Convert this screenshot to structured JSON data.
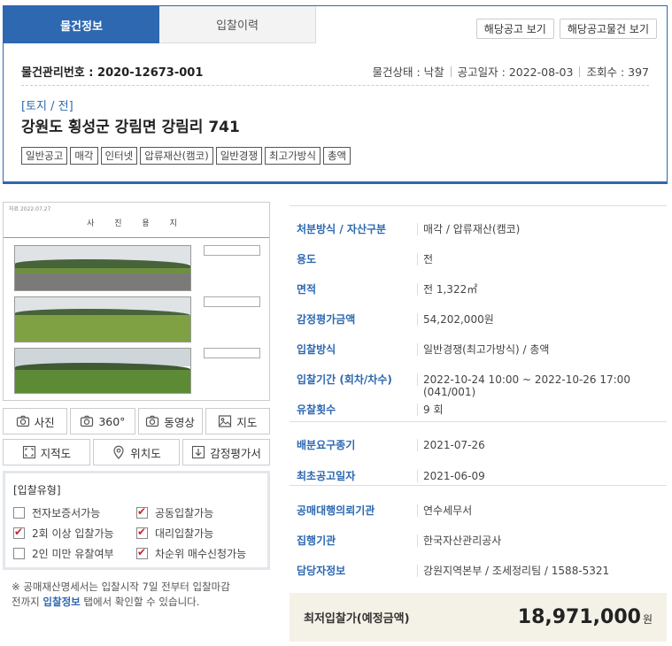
{
  "tabs": [
    {
      "label": "물건정보",
      "active": true
    },
    {
      "label": "입찰이력",
      "active": false
    }
  ],
  "top_buttons": {
    "notice": "해당공고 보기",
    "notice_items": "해당공고물건 보기"
  },
  "meta": {
    "mgmt_label": "물건관리번호 :",
    "mgmt_no": "2020-12673-001",
    "status": "물건상태 : 낙찰",
    "date": "공고일자 : 2022-08-03",
    "views": "조회수 : 397"
  },
  "category": "[토지 / 전]",
  "address": "강원도 횡성군 강림면 강림리 741",
  "tags": [
    "일반공고",
    "매각",
    "인터넷",
    "압류재산(캠코)",
    "일반경쟁",
    "최고가방식",
    "총액"
  ],
  "thumbnail": {
    "doc_title": "사 진 용 지",
    "doc_small": "자료 2022.07.27"
  },
  "media_buttons": {
    "row1": [
      {
        "label": "사진",
        "icon": "camera-icon"
      },
      {
        "label": "360°",
        "icon": "camera-360-icon"
      },
      {
        "label": "동영상",
        "icon": "video-camera-icon"
      },
      {
        "label": "지도",
        "icon": "image-icon"
      }
    ],
    "row2": [
      {
        "label": "지적도",
        "icon": "cadastral-map-icon"
      },
      {
        "label": "위치도",
        "icon": "location-pin-icon"
      },
      {
        "label": "감정평가서",
        "icon": "download-icon"
      }
    ]
  },
  "bid_types": {
    "title": "[입찰유형]",
    "items": [
      {
        "label": "전자보증서가능",
        "checked": false
      },
      {
        "label": "공동입찰가능",
        "checked": true
      },
      {
        "label": "2회 이상 입찰가능",
        "checked": true
      },
      {
        "label": "대리입찰가능",
        "checked": true
      },
      {
        "label": "2인 미만 유찰여부",
        "checked": false
      },
      {
        "label": "차순위 매수신청가능",
        "checked": true
      }
    ]
  },
  "footnote": {
    "line1": "※ 공매재산명세서는 입찰시작 7일 전부터 입찰마감",
    "line2_pre": "전까지 ",
    "link": "입찰정보",
    "line2_post": " 탭에서 확인할 수 있습니다."
  },
  "info": [
    {
      "k": "처분방식 / 자산구분",
      "v": "매각 / 압류재산(캠코)"
    },
    {
      "k": "용도",
      "v": "전"
    },
    {
      "k": "면적",
      "v": "전 1,322㎡"
    },
    {
      "k": "감정평가금액",
      "v": "54,202,000원"
    },
    {
      "k": "입찰방식",
      "v": "일반경쟁(최고가방식) / 총액"
    },
    {
      "k": "입찰기간 (회차/차수)",
      "v": "2022-10-24 10:00 ~ 2022-10-26 17:00 (041/001)"
    },
    {
      "k": "유찰횟수",
      "v": "9 회"
    },
    {
      "k": "배분요구종기",
      "v": "2021-07-26"
    },
    {
      "k": "최초공고일자",
      "v": "2021-06-09"
    },
    {
      "k": "공매대행의뢰기관",
      "v": "연수세무서"
    },
    {
      "k": "집행기관",
      "v": "한국자산관리공사"
    },
    {
      "k": "담당자정보",
      "v": "강원지역본부 / 조세정리팀 / 1588-5321"
    }
  ],
  "price": {
    "label": "최저입찰가(예정금액)",
    "value": "18,971,000",
    "unit": "원"
  }
}
